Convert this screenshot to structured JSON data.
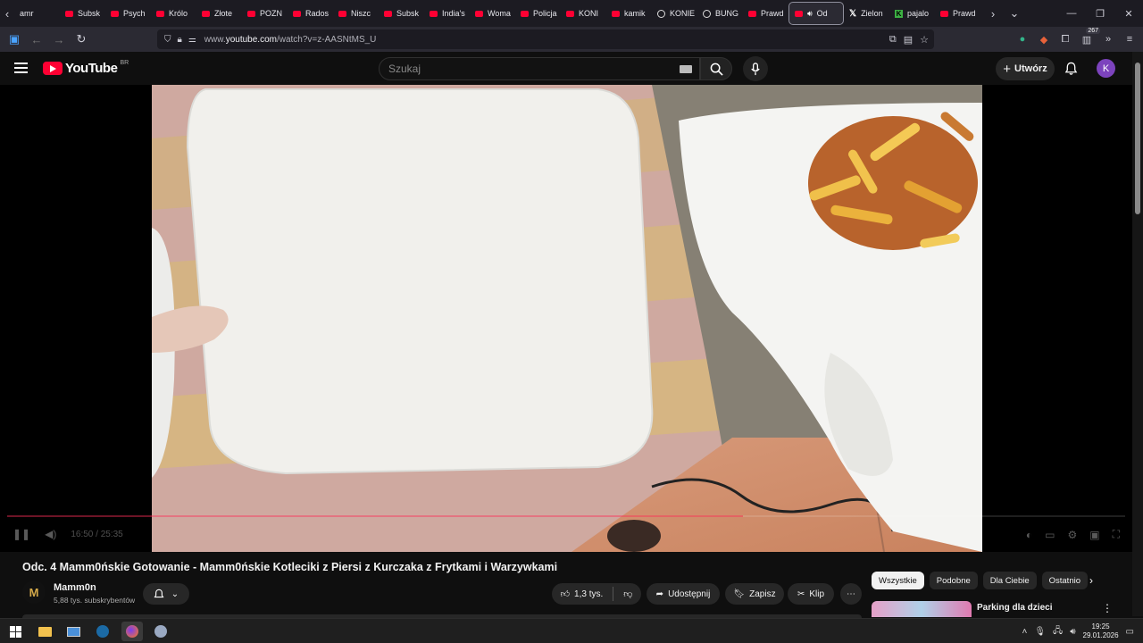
{
  "browser": {
    "tabs": [
      {
        "label": "amr",
        "icon": "none"
      },
      {
        "label": "Subsk",
        "icon": "youtube"
      },
      {
        "label": "Psych",
        "icon": "youtube"
      },
      {
        "label": "Królo",
        "icon": "youtube"
      },
      {
        "label": "Złote",
        "icon": "youtube"
      },
      {
        "label": "POZN",
        "icon": "youtube"
      },
      {
        "label": "Rados",
        "icon": "youtube"
      },
      {
        "label": "Niszc",
        "icon": "youtube"
      },
      {
        "label": "Subsk",
        "icon": "youtube"
      },
      {
        "label": "India's",
        "icon": "youtube"
      },
      {
        "label": "Woma",
        "icon": "youtube"
      },
      {
        "label": "Policja",
        "icon": "youtube"
      },
      {
        "label": "KONI",
        "icon": "youtube"
      },
      {
        "label": "kamik",
        "icon": "youtube"
      },
      {
        "label": "KONIE",
        "icon": "circle"
      },
      {
        "label": "BUNG",
        "icon": "circle"
      },
      {
        "label": "Prawd",
        "icon": "youtube"
      },
      {
        "label": "Od",
        "icon": "youtube",
        "active": true,
        "audio": true
      },
      {
        "label": "Zielon",
        "icon": "x"
      },
      {
        "label": "pajalo",
        "icon": "k"
      },
      {
        "label": "Prawd",
        "icon": "youtube"
      }
    ],
    "url_prefix": "www.",
    "url_domain": "youtube.com",
    "url_path": "/watch?v=z-AASNtMS_U",
    "extension_badge": "267"
  },
  "youtube": {
    "logo_text": "YouTube",
    "region": "BR",
    "search_placeholder": "Szukaj",
    "create_label": "Utwórz",
    "avatar_letter": "K"
  },
  "player": {
    "time_current": "16:50",
    "time_total": "25:35",
    "time_separator": " / ",
    "progress_fraction": 0.658
  },
  "video": {
    "title": "Odc. 4 Mamm0ńskie Gotowanie - Mamm0ńskie Kotleciki z Piersi z Kurczaka z Frytkami i Warzywkami",
    "channel_name": "Mamm0n",
    "channel_avatar_letter": "M",
    "subscribers": "5,88 tys. subskrybentów",
    "likes": "1,3 tys.",
    "share_label": "Udostępnij",
    "save_label": "Zapisz",
    "clip_label": "Klip"
  },
  "sidebar": {
    "chips": [
      {
        "label": "Wszystkie",
        "active": true
      },
      {
        "label": "Podobne",
        "active": false
      },
      {
        "label": "Dla Ciebie",
        "active": false
      },
      {
        "label": "Ostatnio",
        "active": false
      }
    ],
    "recommendation_title": "Parking dla dzieci"
  },
  "taskbar": {
    "time": "19:25",
    "date": "29.01.2026"
  },
  "colors": {
    "accent_red": "#ff0033",
    "background": "#0f0f0f",
    "avatar": "#7c43bd"
  }
}
